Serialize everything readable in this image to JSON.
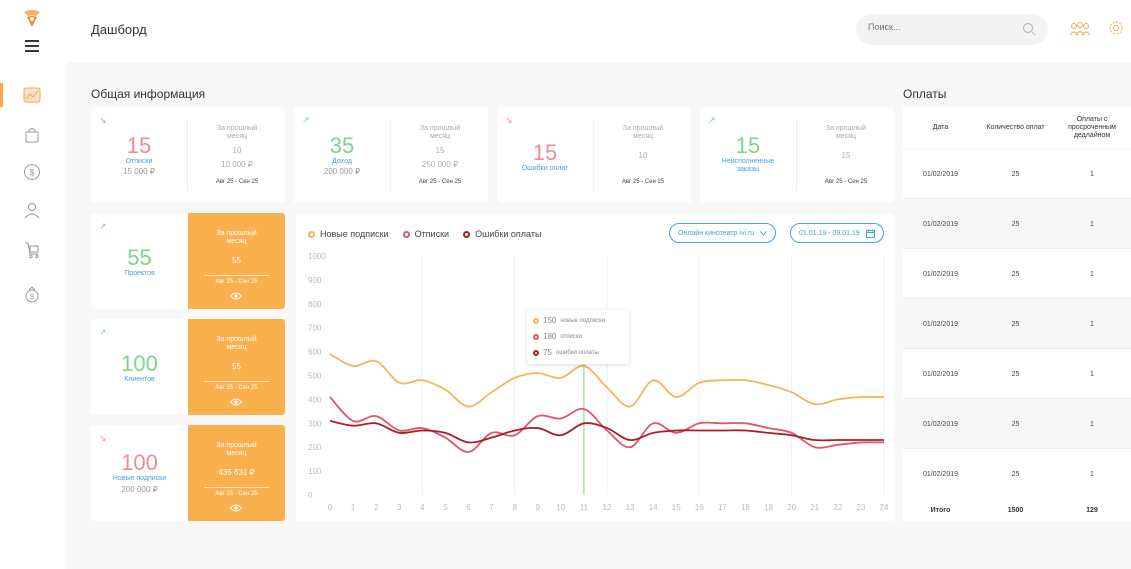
{
  "header": {
    "title": "Дашборд",
    "search_placeholder": "Поиск..."
  },
  "colors": {
    "accent": "#fbb04e",
    "red": "#f08a96",
    "green": "#7fd38a",
    "blue": "#4aa0e0"
  },
  "sidebar": {
    "items": [
      {
        "icon": "chart-icon"
      },
      {
        "icon": "bag-icon"
      },
      {
        "icon": "dollar-icon"
      },
      {
        "icon": "user-icon"
      },
      {
        "icon": "cart-icon"
      },
      {
        "icon": "money-bag-icon"
      }
    ]
  },
  "overview": {
    "title": "Общая информация",
    "cards": [
      {
        "arrow": "↘",
        "num": "15",
        "label": "Отписки",
        "sub": "15 000 ₽",
        "right_title": "За прошлый месяц",
        "right_values": [
          "10",
          "10 000 ₽"
        ],
        "dates": "Авг 25 - Сен 25"
      },
      {
        "arrow": "↗",
        "num": "35",
        "label": "Доход",
        "sub": "200 000 ₽",
        "right_title": "За прошлый месяц",
        "right_values": [
          "15",
          "250 000 ₽"
        ],
        "dates": "Авг 25 - Сен 25"
      },
      {
        "arrow": "↘",
        "num": "15",
        "label": "Ошибки оплат",
        "sub": "",
        "right_title": "За прошлый месяц",
        "right_values": [
          "10"
        ],
        "dates": "Авг 25 - Сен 25"
      },
      {
        "arrow": "↗",
        "num": "15",
        "label": "Неисполненные заказы",
        "sub": "",
        "right_title": "За прошлый месяц",
        "right_values": [
          "15"
        ],
        "dates": "Авг 25 - Сен 25"
      }
    ],
    "side_cards": [
      {
        "arrow": "↗",
        "num": "55",
        "label": "Проектов",
        "sub": "",
        "o_title": "За прошлый месяц",
        "o_value": "55",
        "o_dates": "Авг 25 - Сен 25"
      },
      {
        "arrow": "↗",
        "num": "100",
        "label": "Клиентов",
        "sub": "",
        "o_title": "За прошлый месяц",
        "o_value": "55",
        "o_dates": "Авг 25 - Сен 25"
      },
      {
        "arrow": "↘",
        "num": "100",
        "label": "Новые подписки",
        "sub": "200 000 ₽",
        "o_title": "За прошлый месяц",
        "o_value": "435 631 ₽",
        "o_dates": "Авг 25 - Сен 25"
      }
    ]
  },
  "chart_panel": {
    "legend": [
      "Новые подписки",
      "Отписки",
      "Ошибки оплаты"
    ],
    "select_label": "Онлайн кинотеатр ivi.ru",
    "date_range": "01.01.19 - 09.01.19",
    "tooltip": [
      {
        "value": "150",
        "label": "новые подписки"
      },
      {
        "value": "180",
        "label": "отписки"
      },
      {
        "value": "75",
        "label": "ошибки оплаты"
      }
    ]
  },
  "chart_data": {
    "type": "line",
    "x": [
      0,
      1,
      2,
      3,
      4,
      5,
      6,
      7,
      8,
      9,
      10,
      11,
      12,
      13,
      14,
      15,
      16,
      17,
      18,
      19,
      20,
      21,
      22,
      23,
      24
    ],
    "ylim": [
      0,
      1000
    ],
    "yticks": [
      0,
      100,
      200,
      300,
      400,
      500,
      600,
      700,
      800,
      900,
      1000
    ],
    "grid": true,
    "highlight_x": 11,
    "series": [
      {
        "name": "Новые подписки",
        "color": "#f5b45a",
        "values": [
          590,
          540,
          560,
          470,
          480,
          440,
          370,
          430,
          490,
          510,
          490,
          540,
          450,
          370,
          480,
          410,
          470,
          480,
          480,
          460,
          430,
          380,
          400,
          410,
          410
        ]
      },
      {
        "name": "Отписки",
        "color": "#e0566a",
        "values": [
          410,
          310,
          330,
          270,
          280,
          240,
          180,
          260,
          250,
          330,
          320,
          360,
          270,
          200,
          300,
          260,
          300,
          300,
          300,
          280,
          260,
          200,
          210,
          220,
          220
        ]
      },
      {
        "name": "Ошибки оплаты",
        "color": "#a81e2a",
        "values": [
          310,
          290,
          300,
          260,
          270,
          260,
          220,
          240,
          270,
          280,
          250,
          300,
          280,
          230,
          260,
          270,
          270,
          270,
          270,
          260,
          250,
          230,
          230,
          230,
          230
        ]
      }
    ]
  },
  "payments": {
    "title": "Оплаты",
    "headers": [
      "Дата",
      "Количество оплат",
      "Оплаты с просроченным дедлайном"
    ],
    "rows": [
      [
        "01/02/2019",
        "25",
        "1"
      ],
      [
        "01/02/2019",
        "25",
        "1"
      ],
      [
        "01/02/2019",
        "25",
        "1"
      ],
      [
        "01/02/2019",
        "25",
        "1"
      ],
      [
        "01/02/2019",
        "25",
        "1"
      ],
      [
        "01/02/2019",
        "25",
        "1"
      ],
      [
        "01/02/2019",
        "25",
        "1"
      ]
    ],
    "total": [
      "Итого",
      "1500",
      "129"
    ]
  }
}
